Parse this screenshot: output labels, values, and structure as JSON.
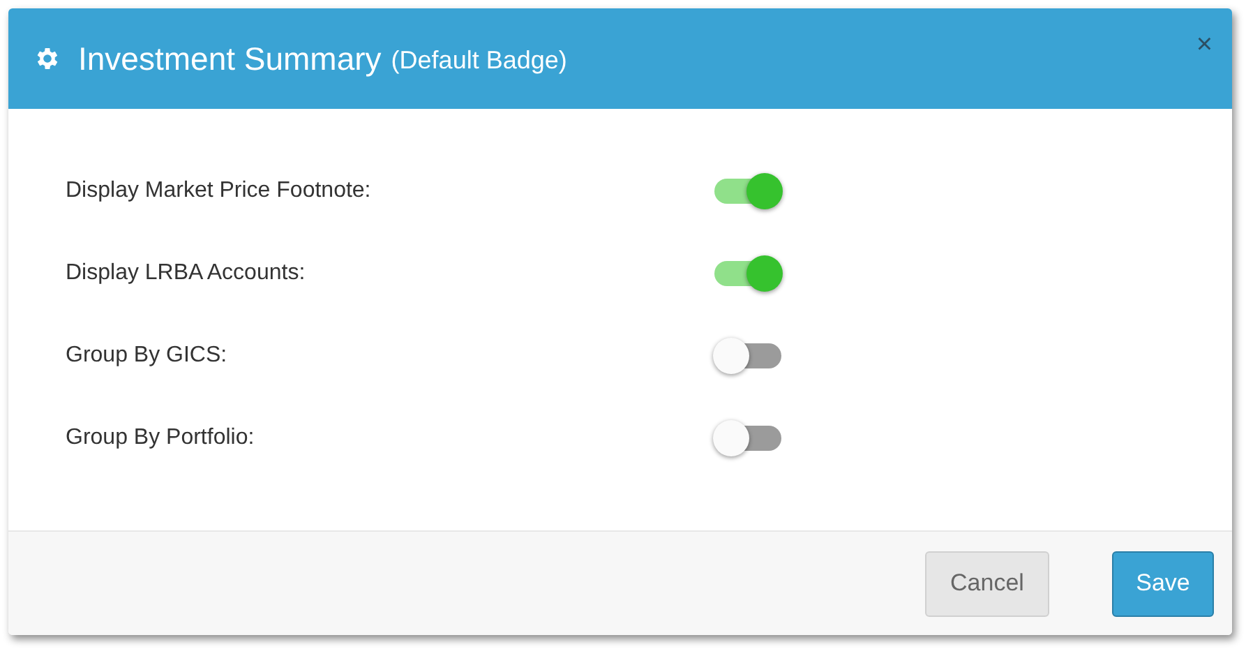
{
  "dialog": {
    "title": "Investment Summary",
    "subtitle": "(Default Badge)",
    "close": "×",
    "settings": [
      {
        "label": "Display Market Price Footnote:",
        "on": true
      },
      {
        "label": "Display LRBA Accounts:",
        "on": true
      },
      {
        "label": "Group By GICS:",
        "on": false
      },
      {
        "label": "Group By Portfolio:",
        "on": false
      }
    ],
    "buttons": [
      {
        "label": "Cancel",
        "kind": "secondary"
      },
      {
        "label": "Save",
        "kind": "primary"
      }
    ]
  }
}
